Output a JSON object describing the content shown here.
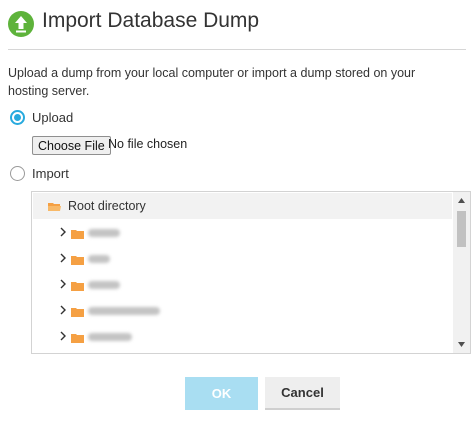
{
  "dialog": {
    "title": "Import Database Dump",
    "title_icon": "upload-arrow-icon",
    "description": "Upload a dump from your local computer or import a dump stored on your hosting server."
  },
  "options": {
    "upload": {
      "label": "Upload",
      "selected": true
    },
    "import": {
      "label": "Import",
      "selected": false
    }
  },
  "file_input": {
    "button_label": "Choose File",
    "status": "No file chosen"
  },
  "tree": {
    "root_label": "Root directory",
    "root_icon": "folder-open-icon",
    "children_icon": "folder-icon",
    "expand_icon": "chevron-right-icon"
  },
  "footer": {
    "ok_label": "OK",
    "cancel_label": "Cancel"
  },
  "colors": {
    "accent": "#28aade",
    "header_icon": "#5eb33b",
    "folder": "#f5a043",
    "ok_disabled": "#a9def2"
  }
}
